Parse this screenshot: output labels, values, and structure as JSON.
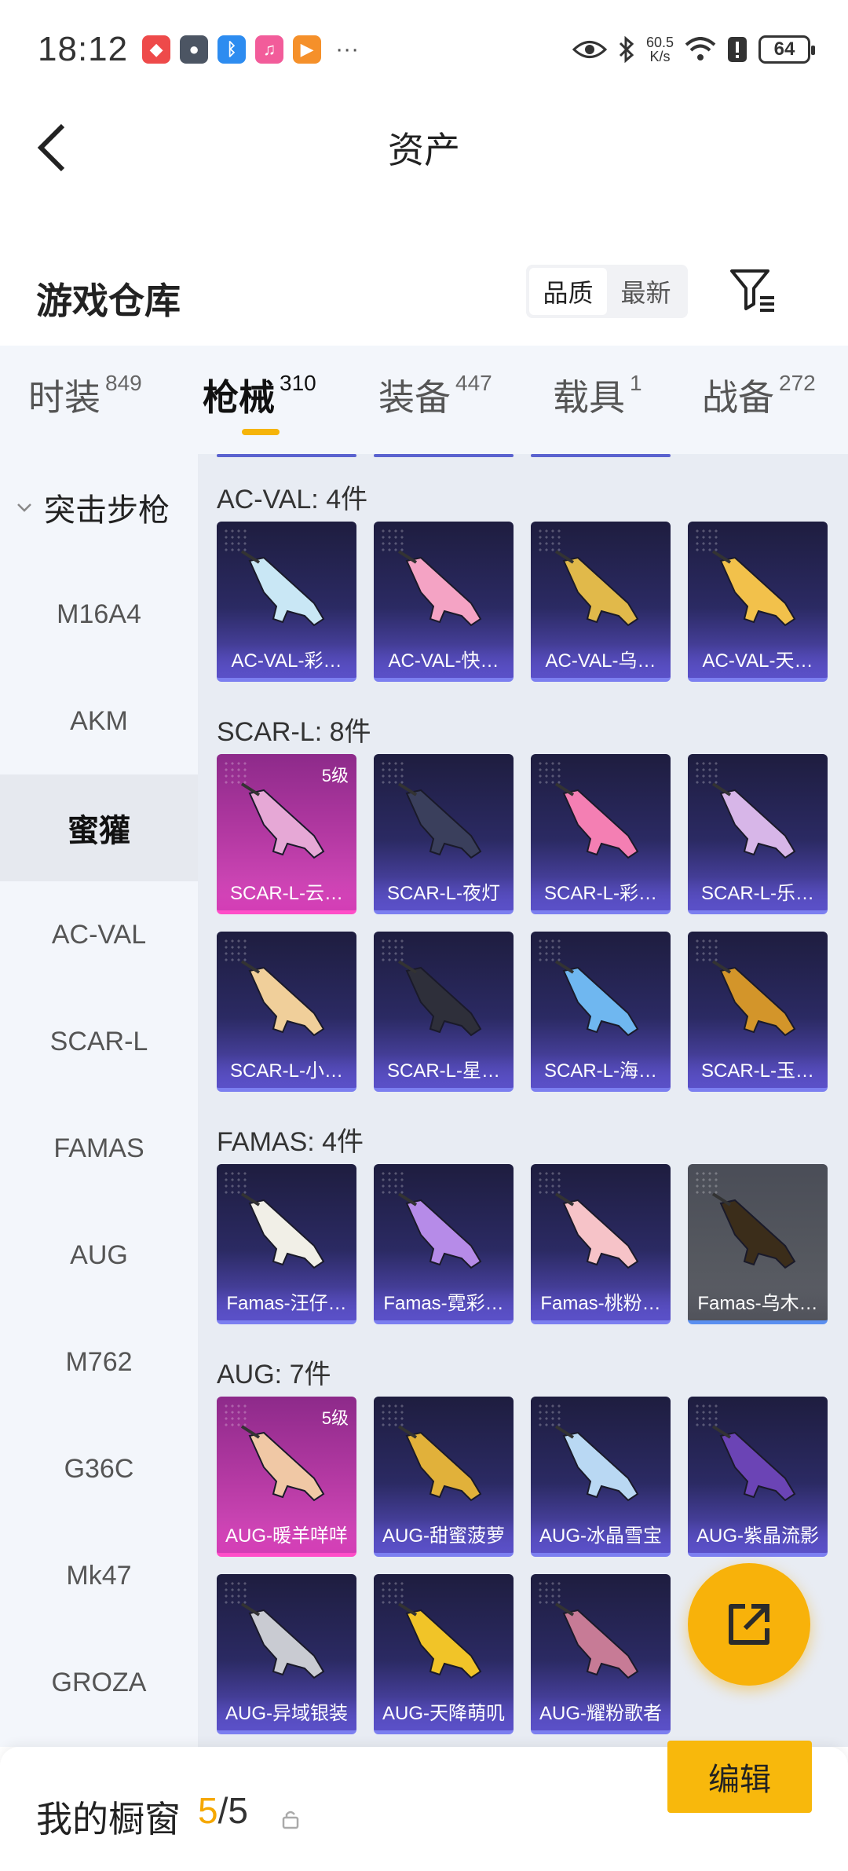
{
  "status_bar": {
    "time": "18:12",
    "net_speed_value": "60.5",
    "net_speed_unit": "K/s",
    "battery": "64"
  },
  "nav": {
    "title": "资产"
  },
  "section": {
    "title": "游戏仓库",
    "sort_options": [
      "品质",
      "最新"
    ],
    "active_sort": "品质"
  },
  "tabs": [
    {
      "label": "时装",
      "count": "849"
    },
    {
      "label": "枪械",
      "count": "310"
    },
    {
      "label": "装备",
      "count": "447"
    },
    {
      "label": "载具",
      "count": "1"
    },
    {
      "label": "战备",
      "count": "272"
    }
  ],
  "active_tab": "枪械",
  "sidebar": {
    "group": "突击步枪",
    "items": [
      "M16A4",
      "AKM",
      "蜜獾",
      "AC-VAL",
      "SCAR-L",
      "FAMAS",
      "AUG",
      "M762",
      "G36C",
      "Mk47",
      "GROZA"
    ],
    "active": "蜜獾"
  },
  "groups": [
    {
      "title": "AC-VAL: 4件",
      "items": [
        {
          "name": "AC-VAL-彩…",
          "style": "normal"
        },
        {
          "name": "AC-VAL-快…",
          "style": "normal"
        },
        {
          "name": "AC-VAL-乌…",
          "style": "normal"
        },
        {
          "name": "AC-VAL-天…",
          "style": "normal"
        }
      ]
    },
    {
      "title": "SCAR-L: 8件",
      "items": [
        {
          "name": "SCAR-L-云…",
          "style": "pink",
          "badge": "5级"
        },
        {
          "name": "SCAR-L-夜灯",
          "style": "normal"
        },
        {
          "name": "SCAR-L-彩…",
          "style": "normal"
        },
        {
          "name": "SCAR-L-乐…",
          "style": "normal"
        },
        {
          "name": "SCAR-L-小…",
          "style": "normal"
        },
        {
          "name": "SCAR-L-星…",
          "style": "normal"
        },
        {
          "name": "SCAR-L-海…",
          "style": "normal"
        },
        {
          "name": "SCAR-L-玉…",
          "style": "normal"
        }
      ]
    },
    {
      "title": "FAMAS: 4件",
      "items": [
        {
          "name": "Famas-汪仔…",
          "style": "normal"
        },
        {
          "name": "Famas-霓彩…",
          "style": "normal"
        },
        {
          "name": "Famas-桃粉…",
          "style": "normal"
        },
        {
          "name": "Famas-乌木…",
          "style": "grey"
        }
      ]
    },
    {
      "title": "AUG: 7件",
      "items": [
        {
          "name": "AUG-暖羊咩咩",
          "style": "pink",
          "badge": "5级"
        },
        {
          "name": "AUG-甜蜜菠萝",
          "style": "normal"
        },
        {
          "name": "AUG-冰晶雪宝",
          "style": "normal"
        },
        {
          "name": "AUG-紫晶流影",
          "style": "normal"
        },
        {
          "name": "AUG-异域银装",
          "style": "normal"
        },
        {
          "name": "AUG-天降萌叽",
          "style": "normal"
        },
        {
          "name": "AUG-耀粉歌者",
          "style": "normal"
        }
      ]
    }
  ],
  "bottom_bar": {
    "label": "我的橱窗",
    "current": "5",
    "separator": "/",
    "total": "5",
    "edit_label": "编辑"
  },
  "icons": {
    "back": "chevron-left-icon",
    "filter": "filter-icon",
    "share": "share-icon",
    "lock": "lock-icon"
  },
  "colors": {
    "accent": "#f8b80c",
    "tab_underline": "#f5b40a",
    "card_normal": "#2b2a63",
    "card_pink": "#b63aa4",
    "card_grey": "#55585f"
  }
}
